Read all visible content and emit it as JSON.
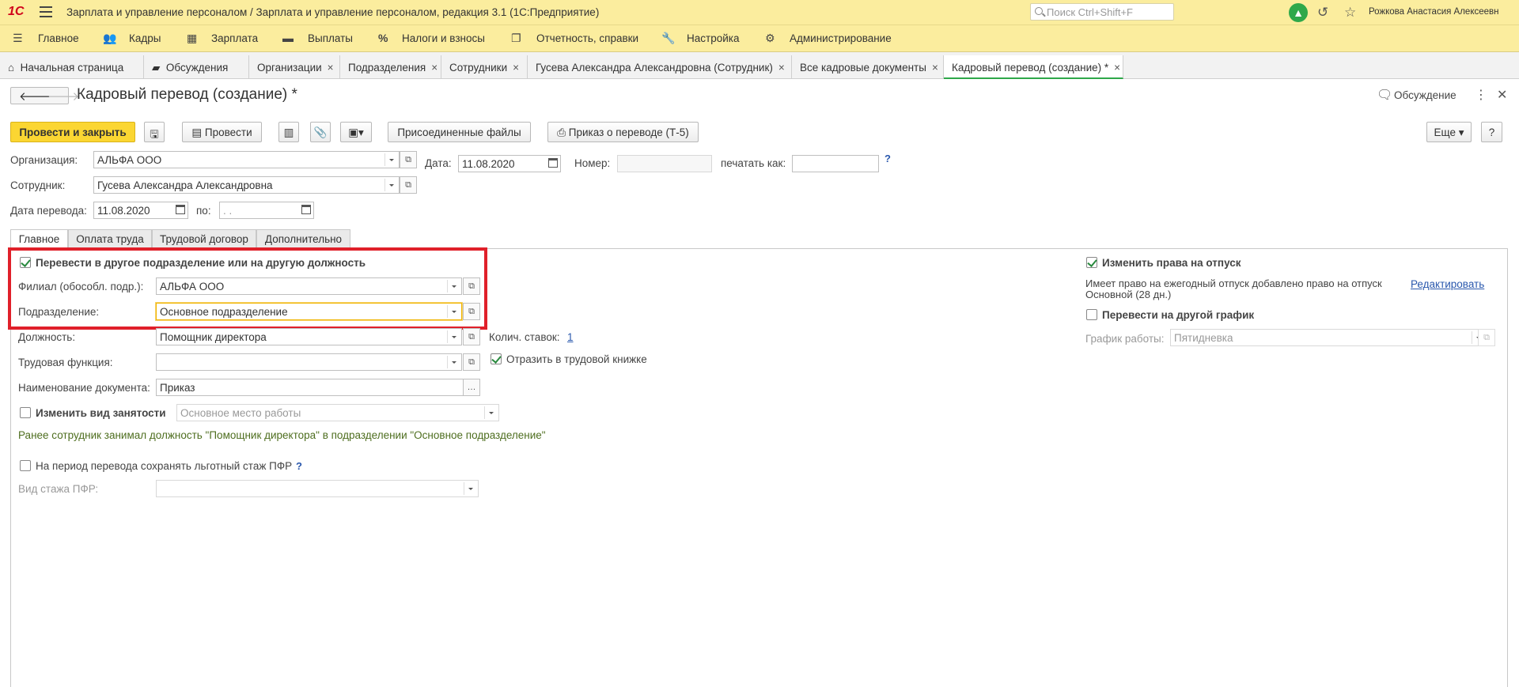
{
  "titlebar": {
    "logo": "1С",
    "title": "Зарплата и управление персоналом / Зарплата и управление персоналом, редакция 3.1  (1С:Предприятие)",
    "search_placeholder": "Поиск Ctrl+Shift+F",
    "username": "Рожкова Анастасия Алексеевн"
  },
  "sections": [
    "Главное",
    "Кадры",
    "Зарплата",
    "Выплаты",
    "Налоги и взносы",
    "Отчетность, справки",
    "Настройка",
    "Администрирование"
  ],
  "window_tabs": [
    "Начальная страница",
    "Обсуждения",
    "Организации",
    "Подразделения",
    "Сотрудники",
    "Гусева Александра Александровна (Сотрудник)",
    "Все кадровые документы",
    "Кадровый перевод (создание) *"
  ],
  "form": {
    "title": "Кадровый перевод (создание) *",
    "discussion": "Обсуждение"
  },
  "commands": {
    "post_close": "Провести и закрыть",
    "post": "Провести",
    "attached_files": "Присоединенные файлы",
    "print_order": "Приказ о переводе (Т-5)",
    "more": "Еще",
    "help": "?"
  },
  "header_fields": {
    "org_label": "Организация:",
    "org_value": "АЛЬФА ООО",
    "date_label": "Дата:",
    "date_value": "11.08.2020",
    "number_label": "Номер:",
    "number_value": "",
    "print_as_label": "печатать как:",
    "print_as_value": "",
    "employee_label": "Сотрудник:",
    "employee_value": "Гусева Александра Александровна",
    "transfer_date_label": "Дата перевода:",
    "transfer_date_value": "11.08.2020",
    "to_label": "по:",
    "to_value": "  .  ."
  },
  "tabs": [
    "Главное",
    "Оплата труда",
    "Трудовой договор",
    "Дополнительно"
  ],
  "main": {
    "transfer_checkbox": "Перевести в другое подразделение или на другую должность",
    "branch_label": "Филиал (обособл. подр.):",
    "branch_value": "АЛЬФА ООО",
    "dept_label": "Подразделение:",
    "dept_value": "Основное подразделение",
    "position_label": "Должность:",
    "position_value": "Помощник директора",
    "rates_label": "Колич. ставок:",
    "rates_value": "1",
    "function_label": "Трудовая функция:",
    "function_value": "",
    "reflect_book": "Отразить в трудовой книжке",
    "docname_label": "Наименование документа:",
    "docname_value": "Приказ",
    "employment_checkbox": "Изменить вид занятости",
    "employment_value": "Основное место работы",
    "previous_note": "Ранее сотрудник занимал должность \"Помощник директора\" в подразделении \"Основное подразделение\"",
    "pfr_checkbox": "На период перевода сохранять льготный стаж ПФР",
    "pfr_kind_label": "Вид стажа ПФР:",
    "pfr_kind_value": ""
  },
  "right": {
    "vacation_checkbox": "Изменить права на отпуск",
    "vacation_text_1": "Имеет право на ежегодный отпуск добавлено право на отпуск",
    "vacation_text_2": "Основной (28 дн.)",
    "edit_link": "Редактировать",
    "schedule_checkbox": "Перевести на другой график",
    "schedule_label": "График работы:",
    "schedule_value": "Пятидневка"
  },
  "colors": {
    "accent_yellow": "#fbed9e",
    "primary_button": "#fbd632",
    "highlight_red": "#e0202a",
    "active_tab_green": "#2ea84a"
  }
}
